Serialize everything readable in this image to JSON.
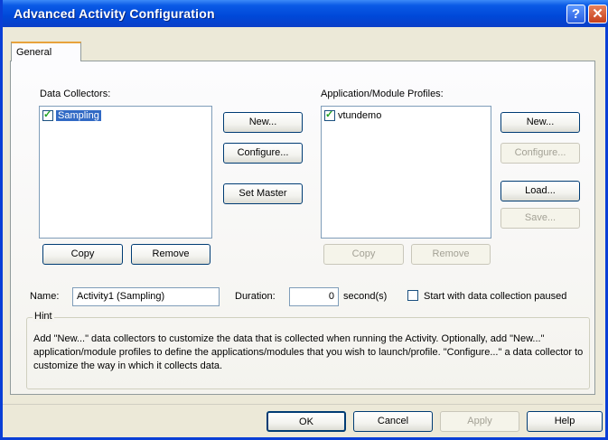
{
  "window": {
    "title": "Advanced Activity Configuration",
    "help_glyph": "?",
    "close_glyph": "✕"
  },
  "tabs": [
    {
      "label": "General"
    }
  ],
  "data_collectors": {
    "label": "Data Collectors:",
    "items": [
      {
        "label": "Sampling",
        "checked": true,
        "selected": true
      }
    ],
    "buttons": {
      "new": "New...",
      "configure": "Configure...",
      "set_master": "Set Master",
      "copy": "Copy",
      "remove": "Remove"
    }
  },
  "profiles": {
    "label": "Application/Module Profiles:",
    "items": [
      {
        "label": "vtundemo",
        "checked": true,
        "selected": false
      }
    ],
    "buttons": {
      "new": "New...",
      "configure": "Configure...",
      "load": "Load...",
      "save": "Save...",
      "copy": "Copy",
      "remove": "Remove"
    }
  },
  "name_field": {
    "label": "Name:",
    "value": "Activity1 (Sampling)"
  },
  "duration_field": {
    "label": "Duration:",
    "value": "0",
    "unit": "second(s)"
  },
  "paused_checkbox": {
    "label": "Start with data collection paused",
    "checked": false
  },
  "hint": {
    "legend": "Hint",
    "text": "Add \"New...\" data collectors to customize the data that is collected when running the Activity.  Optionally, add \"New...\" application/module profiles to define the applications/modules that you wish to launch/profile.  \"Configure...\" a data collector to customize the way in which it collects data."
  },
  "footer_buttons": {
    "ok": "OK",
    "cancel": "Cancel",
    "apply": "Apply",
    "help": "Help"
  },
  "colors": {
    "title_bar": "#0048d8",
    "selection": "#316ac5",
    "tab_highlight": "#e8a33c",
    "dialog_bg": "#ece9d8"
  }
}
